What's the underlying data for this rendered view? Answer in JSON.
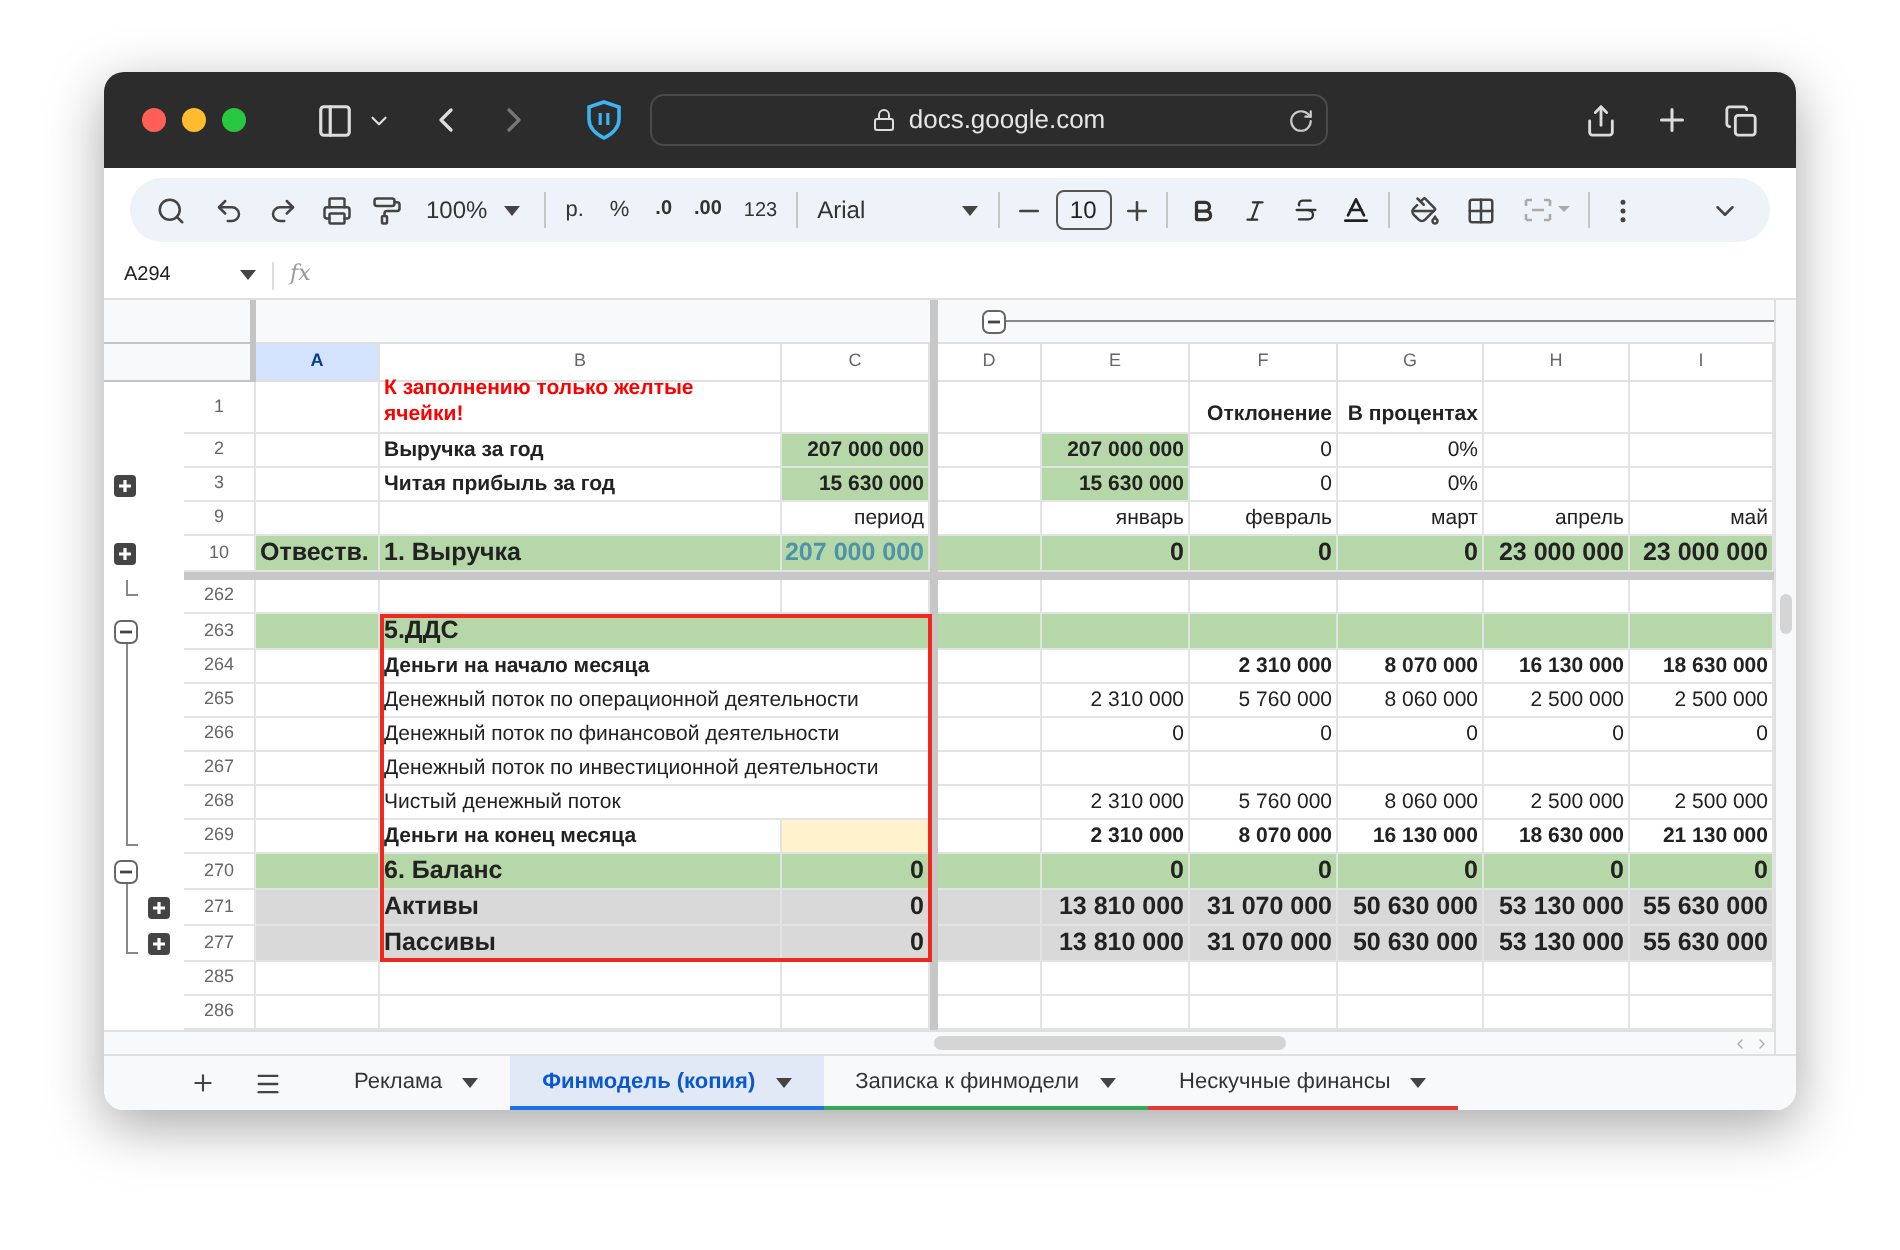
{
  "browser": {
    "url": "docs.google.com"
  },
  "toolbar": {
    "zoom": "100%",
    "currency": "р.",
    "percent": "%",
    "decrease_decimals": ".0",
    "increase_decimals": ".00",
    "number_format": "123",
    "font": "Arial",
    "font_size": "10"
  },
  "name_box": {
    "value": "A294",
    "formula_label": "fx"
  },
  "column_group": {
    "expanded": true
  },
  "columns": [
    {
      "letter": "A",
      "selected": true
    },
    {
      "letter": "B",
      "selected": false
    },
    {
      "letter": "C",
      "selected": false
    },
    {
      "letter": "D",
      "selected": false
    },
    {
      "letter": "E",
      "selected": false
    },
    {
      "letter": "F",
      "selected": false
    },
    {
      "letter": "G",
      "selected": false
    },
    {
      "letter": "H",
      "selected": false
    },
    {
      "letter": "I",
      "selected": false
    }
  ],
  "frozen_rows": [
    {
      "number": "1",
      "kind": "note",
      "cells": [
        null,
        {
          "text": "К заполнению только желтые ячейки!",
          "kind": "warning"
        },
        null,
        null,
        null,
        {
          "text": "Отклонение",
          "kind": "bold"
        },
        {
          "text": "В процентах",
          "kind": "bold"
        },
        null,
        null
      ]
    },
    {
      "number": "2",
      "kind": "plain",
      "cells": [
        null,
        {
          "text": "Выручка за год",
          "kind": "bold"
        },
        {
          "text": "207 000 000",
          "kind": "filled"
        },
        null,
        {
          "text": "207 000 000",
          "kind": "filled"
        },
        {
          "text": "0"
        },
        {
          "text": "0%"
        },
        null,
        null
      ]
    },
    {
      "number": "3",
      "kind": "plain",
      "toggle": {
        "expanded": false
      },
      "cells": [
        null,
        {
          "text": "Читая прибыль за год",
          "kind": "bold"
        },
        {
          "text": "15 630 000",
          "kind": "filled"
        },
        null,
        {
          "text": "15 630 000",
          "kind": "filled"
        },
        {
          "text": "0"
        },
        {
          "text": "0%"
        },
        null,
        null
      ]
    },
    {
      "number": "9",
      "kind": "plain",
      "cells": [
        null,
        null,
        {
          "text": "период"
        },
        null,
        {
          "text": "январь"
        },
        {
          "text": "февраль"
        },
        {
          "text": "март"
        },
        {
          "text": "апрель"
        },
        {
          "text": "май"
        }
      ]
    },
    {
      "number": "10",
      "kind": "section",
      "toggle": {
        "expanded": false
      },
      "cells": [
        {
          "text": "Отвеств."
        },
        {
          "text": "1. Выручка"
        },
        {
          "text": "207 000 000",
          "kind": "faded"
        },
        null,
        {
          "text": "0"
        },
        {
          "text": "0"
        },
        {
          "text": "0"
        },
        {
          "text": "23 000 000"
        },
        {
          "text": "23 000 000"
        }
      ]
    }
  ],
  "rows": [
    {
      "number": "262",
      "kind": "plain",
      "group_end": true,
      "cells": [
        null,
        null,
        null,
        null,
        null,
        null,
        null,
        null,
        null
      ]
    },
    {
      "number": "263",
      "kind": "section",
      "toggle": {
        "expanded": true
      },
      "cells": [
        null,
        {
          "text": "5.ДДС",
          "kind": "bold"
        },
        null,
        null,
        null,
        null,
        null,
        null,
        null
      ]
    },
    {
      "number": "264",
      "kind": "bold",
      "in_group": true,
      "cells": [
        null,
        {
          "text": "Деньги на начало месяца"
        },
        null,
        null,
        null,
        {
          "text": "2 310 000"
        },
        {
          "text": "8 070 000"
        },
        {
          "text": "16 130 000"
        },
        {
          "text": "18 630 000"
        }
      ]
    },
    {
      "number": "265",
      "kind": "plain",
      "in_group": true,
      "cells": [
        null,
        {
          "text": "Денежный поток по операционной деятельности"
        },
        null,
        null,
        {
          "text": "2 310 000"
        },
        {
          "text": "5 760 000"
        },
        {
          "text": "8 060 000"
        },
        {
          "text": "2 500 000"
        },
        {
          "text": "2 500 000"
        }
      ]
    },
    {
      "number": "266",
      "kind": "plain",
      "in_group": true,
      "cells": [
        null,
        {
          "text": "Денежный поток по финансовой деятельности"
        },
        null,
        null,
        {
          "text": "0"
        },
        {
          "text": "0"
        },
        {
          "text": "0"
        },
        {
          "text": "0"
        },
        {
          "text": "0"
        }
      ]
    },
    {
      "number": "267",
      "kind": "plain",
      "in_group": true,
      "cells": [
        null,
        {
          "text": "Денежный поток по инвестиционной деятельности"
        },
        null,
        null,
        null,
        null,
        null,
        null,
        null
      ]
    },
    {
      "number": "268",
      "kind": "plain",
      "in_group": true,
      "cells": [
        null,
        {
          "text": "Чистый денежный поток"
        },
        null,
        null,
        {
          "text": "2 310 000"
        },
        {
          "text": "5 760 000"
        },
        {
          "text": "8 060 000"
        },
        {
          "text": "2 500 000"
        },
        {
          "text": "2 500 000"
        }
      ]
    },
    {
      "number": "269",
      "kind": "bold",
      "in_group": true,
      "group_end": true,
      "cells": [
        null,
        {
          "text": "Деньги на конец месяца"
        },
        {
          "kind": "input"
        },
        null,
        {
          "text": "2 310 000"
        },
        {
          "text": "8 070 000"
        },
        {
          "text": "16 130 000"
        },
        {
          "text": "18 630 000"
        },
        {
          "text": "21 130 000"
        }
      ]
    },
    {
      "number": "270",
      "kind": "section",
      "toggle": {
        "expanded": true
      },
      "cells": [
        null,
        {
          "text": "6. Баланс"
        },
        {
          "text": "0"
        },
        null,
        {
          "text": "0"
        },
        {
          "text": "0"
        },
        {
          "text": "0"
        },
        {
          "text": "0"
        },
        {
          "text": "0"
        }
      ]
    },
    {
      "number": "271",
      "kind": "total",
      "in_group": true,
      "toggle": {
        "expanded": false
      },
      "cells": [
        null,
        {
          "text": "Активы"
        },
        {
          "text": "0"
        },
        null,
        {
          "text": "13 810 000"
        },
        {
          "text": "31 070 000"
        },
        {
          "text": "50 630 000"
        },
        {
          "text": "53 130 000"
        },
        {
          "text": "55 630 000"
        }
      ]
    },
    {
      "number": "277",
      "kind": "total",
      "in_group": true,
      "group_end": true,
      "toggle": {
        "expanded": false
      },
      "cells": [
        null,
        {
          "text": "Пассивы"
        },
        {
          "text": "0"
        },
        null,
        {
          "text": "13 810 000"
        },
        {
          "text": "31 070 000"
        },
        {
          "text": "50 630 000"
        },
        {
          "text": "53 130 000"
        },
        {
          "text": "55 630 000"
        }
      ]
    },
    {
      "number": "285",
      "kind": "plain",
      "cells": [
        null,
        null,
        null,
        null,
        null,
        null,
        null,
        null,
        null
      ]
    },
    {
      "number": "286",
      "kind": "plain",
      "cells": [
        null,
        null,
        null,
        null,
        null,
        null,
        null,
        null,
        null
      ]
    }
  ],
  "sheets": [
    {
      "name": "Реклама",
      "selected": false
    },
    {
      "name": "Финмодель (копия)",
      "selected": true,
      "color": "#1a73e8"
    },
    {
      "name": "Записка к финмодели",
      "selected": false,
      "color": "#34a853"
    },
    {
      "name": "Нескучные финансы",
      "selected": false,
      "color": "#e53935"
    }
  ]
}
